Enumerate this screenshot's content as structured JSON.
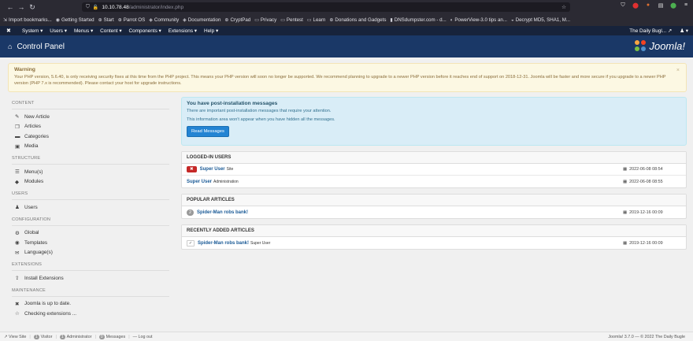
{
  "browser": {
    "url_host": "10.10.78.48",
    "url_path": "/administrator/index.php",
    "bookmarks": [
      {
        "label": "Import bookmarks...",
        "icon": "import-icon"
      },
      {
        "label": "Getting Started",
        "icon": "firefox-icon"
      },
      {
        "label": "Start",
        "icon": "globe-icon"
      },
      {
        "label": "Parrot OS",
        "icon": "globe-icon"
      },
      {
        "label": "Community",
        "icon": "community-icon"
      },
      {
        "label": "Documentation",
        "icon": "doc-icon"
      },
      {
        "label": "CryptPad",
        "icon": "globe-icon"
      },
      {
        "label": "Privacy",
        "icon": "folder-icon"
      },
      {
        "label": "Pentest",
        "icon": "folder-icon"
      },
      {
        "label": "Learn",
        "icon": "folder-icon"
      },
      {
        "label": "Donations and Gadgets",
        "icon": "globe-icon"
      },
      {
        "label": "DNSdumpster.com - d...",
        "icon": "dns-icon"
      },
      {
        "label": "PowerView-3.0 tips an...",
        "icon": "github-icon"
      },
      {
        "label": "Decrypt MD5, SHA1, M...",
        "icon": "decrypt-icon"
      }
    ]
  },
  "topmenu": {
    "items": [
      "System",
      "Users",
      "Menus",
      "Content",
      "Components",
      "Extensions",
      "Help"
    ],
    "site_name": "The Daily Bugl...",
    "user_caret": "▾"
  },
  "header": {
    "title": "Control Panel",
    "logo_text": "Joomla!"
  },
  "warning": {
    "title": "Warning",
    "text": "Your PHP version, 5.6.40, is only receiving security fixes at this time from the PHP project. This means your PHP version will soon no longer be supported. We recommend planning to upgrade to a newer PHP version before it reaches end of support on 2018-12-31. Joomla will be faster and more secure if you upgrade to a newer PHP version (PHP 7.x is recommended). Please contact your host for upgrade instructions.",
    "close": "×"
  },
  "sidebar": {
    "sections": [
      {
        "heading": "CONTENT",
        "items": [
          {
            "label": "New Article",
            "icon": "pencil-icon",
            "glyph": "✎"
          },
          {
            "label": "Articles",
            "icon": "stack-icon",
            "glyph": "❐"
          },
          {
            "label": "Categories",
            "icon": "folder-icon",
            "glyph": "▬"
          },
          {
            "label": "Media",
            "icon": "image-icon",
            "glyph": "▣"
          }
        ]
      },
      {
        "heading": "STRUCTURE",
        "items": [
          {
            "label": "Menu(s)",
            "icon": "list-icon",
            "glyph": "☰"
          },
          {
            "label": "Modules",
            "icon": "cube-icon",
            "glyph": "◆"
          }
        ]
      },
      {
        "heading": "USERS",
        "items": [
          {
            "label": "Users",
            "icon": "users-icon",
            "glyph": "♟"
          }
        ]
      },
      {
        "heading": "CONFIGURATION",
        "items": [
          {
            "label": "Global",
            "icon": "cog-icon",
            "glyph": "⚙"
          },
          {
            "label": "Templates",
            "icon": "eye-icon",
            "glyph": "◉"
          },
          {
            "label": "Language(s)",
            "icon": "comments-icon",
            "glyph": "✉"
          }
        ]
      },
      {
        "heading": "EXTENSIONS",
        "items": [
          {
            "label": "Install Extensions",
            "icon": "upload-icon",
            "glyph": "⇪"
          }
        ]
      },
      {
        "heading": "MAINTENANCE",
        "items": [
          {
            "label": "Joomla is up to date.",
            "icon": "joomla-icon",
            "glyph": "✖"
          },
          {
            "label": "Checking extensions ...",
            "icon": "star-icon",
            "glyph": "☆"
          }
        ]
      }
    ]
  },
  "postinstall": {
    "title": "You have post-installation messages",
    "line1": "There are important post-installation messages that require your attention.",
    "line2": "This information area won't appear when you have hidden all the messages.",
    "button": "Read Messages"
  },
  "logged_in": {
    "heading": "LOGGED-IN USERS",
    "rows": [
      {
        "badge": "✖",
        "name": "Super User",
        "sub": "Site",
        "date": "2022-06-08 08:54"
      },
      {
        "badge": "",
        "name": "Super User",
        "sub": "Administration",
        "date": "2022-06-08 08:55"
      }
    ]
  },
  "popular": {
    "heading": "POPULAR ARTICLES",
    "rows": [
      {
        "count": "2",
        "title": "Spider-Man robs bank!",
        "date": "2019-12-16 00:09"
      }
    ]
  },
  "recent": {
    "heading": "RECENTLY ADDED ARTICLES",
    "rows": [
      {
        "check": "✓",
        "title": "Spider-Man robs bank!",
        "author": "Super User",
        "date": "2019-12-16 00:09"
      }
    ]
  },
  "footer": {
    "view_site": "View Site",
    "visitor_count": "1",
    "visitor_label": "Visitor",
    "admin_count": "1",
    "admin_label": "Administrator",
    "messages_count": "0",
    "messages_label": "Messages",
    "logout": "Log out",
    "version": "Joomla! 3.7.0 — © 2022 The Daily Bugle"
  }
}
